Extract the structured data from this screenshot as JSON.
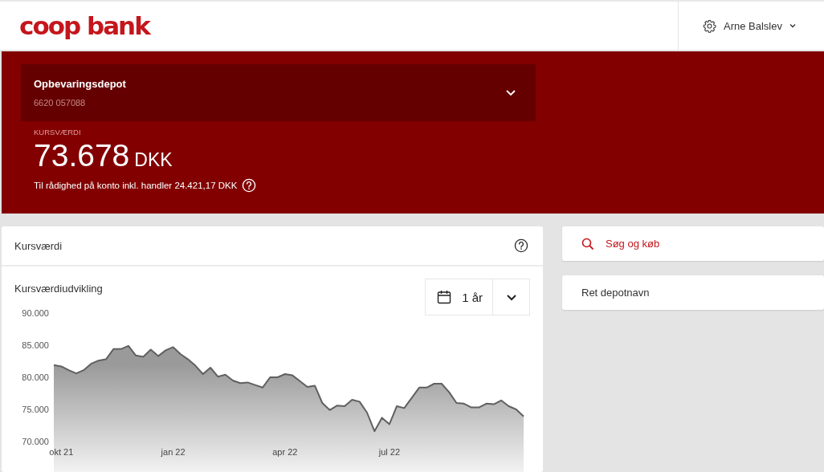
{
  "header": {
    "logo": "coop bank",
    "user": "Arne Balslev"
  },
  "account": {
    "name": "Opbevaringsdepot",
    "number": "6620 057088",
    "expanded": false
  },
  "value": {
    "label": "KURSVÆRDI",
    "amount": "73.678",
    "currency": "DKK",
    "available": "Til rådighed på konto inkl. handler 24.421,17 DKK"
  },
  "card": {
    "title": "Kursværdi",
    "chart_title": "Kursværdiudvikling",
    "period": "1 år",
    "chart_data": {
      "type": "area",
      "categories": [
        null,
        "okt 21",
        null,
        null,
        null,
        null,
        null,
        null,
        null,
        null,
        null,
        null,
        null,
        null,
        null,
        null,
        "jan 22",
        null,
        null,
        null,
        null,
        null,
        null,
        null,
        null,
        null,
        null,
        null,
        null,
        null,
        null,
        "apr 22",
        null,
        null,
        null,
        null,
        null,
        null,
        null,
        null,
        null,
        null,
        null,
        null,
        null,
        "jul 22",
        null,
        null,
        null,
        null,
        null,
        null,
        null,
        null,
        null,
        null,
        null,
        null,
        null,
        null,
        null,
        null,
        null,
        null
      ],
      "series": [
        {
          "color": "#606060",
          "values": [
            81900,
            81700,
            81100,
            80600,
            81100,
            82100,
            82600,
            82800,
            84400,
            84400,
            84900,
            83400,
            83200,
            84300,
            83300,
            84200,
            84700,
            83600,
            82800,
            81800,
            80500,
            81500,
            80100,
            80400,
            79500,
            79100,
            79200,
            78800,
            78400,
            80000,
            80000,
            80500,
            80300,
            79400,
            78500,
            78700,
            76000,
            74900,
            75600,
            75500,
            76500,
            76200,
            74500,
            71600,
            73700,
            72700,
            75500,
            75200,
            76800,
            78400,
            78400,
            79000,
            79000,
            77700,
            76000,
            75900,
            75300,
            75300,
            75900,
            75800,
            76400,
            75500,
            75000,
            73900
          ]
        }
      ],
      "ylim": [
        70000,
        90000
      ],
      "yticks": [
        {
          "value": 90000,
          "label": "90.000"
        },
        {
          "value": 85000,
          "label": "85.000"
        },
        {
          "value": 80000,
          "label": "80.000"
        },
        {
          "value": 75000,
          "label": "75.000"
        },
        {
          "value": 70000,
          "label": "70.000"
        }
      ]
    }
  },
  "actions": [
    {
      "label": "Søg og køb",
      "kind": "search"
    },
    {
      "label": "Ret depotnavn",
      "kind": "plain"
    }
  ]
}
